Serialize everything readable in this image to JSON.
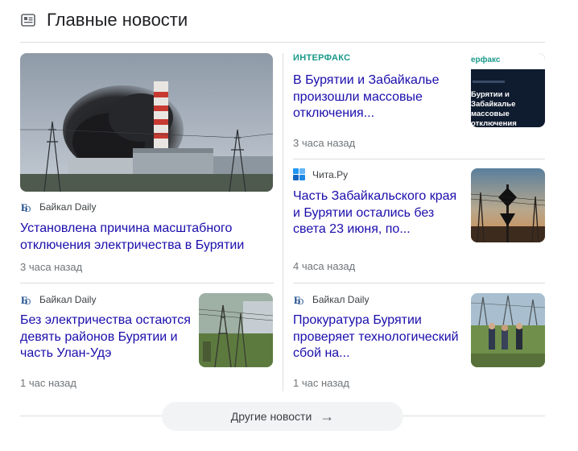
{
  "header": {
    "title": "Главные новости",
    "icon": "news-icon"
  },
  "more_button": {
    "label": "Другие новости",
    "icon": "arrow-right-icon"
  },
  "articles": [
    {
      "source": "Байкал Daily",
      "title": "Установлена причина масштабного отключения электричества в Бурятии",
      "time": "3 часа назад"
    },
    {
      "source": "ИНТЕРФАКС",
      "title": "В Бурятии и Забайкалье произошли массовые отключения...",
      "time": "3 часа назад",
      "thumb_text": {
        "brand": "ерфакс",
        "body": "Бурятии и Забайкалье массовые отключения лектроэнергии"
      }
    },
    {
      "source": "Чита.Ру",
      "title": "Часть Забайкальского края и Бурятии остались без света 23 июня, по...",
      "time": "4 часа назад"
    },
    {
      "source": "Байкал Daily",
      "title": "Без электричества остаются девять районов Бурятии и часть Улан-Удэ",
      "time": "1 час назад"
    },
    {
      "source": "Байкал Daily",
      "title": "Прокуратура Бурятии проверяет технологический сбой на...",
      "time": "1 час назад"
    }
  ],
  "colors": {
    "link": "#1a0dab",
    "meta": "#70757a",
    "divider": "#dadce0",
    "interfax_green": "#1b9a8b",
    "chita_blue": "#1e88e5"
  }
}
